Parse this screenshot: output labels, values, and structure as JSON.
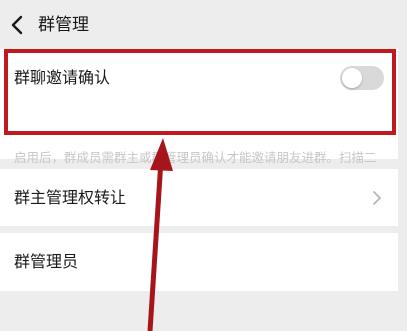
{
  "header": {
    "title": "群管理"
  },
  "settings": {
    "invite_confirm": {
      "label": "群聊邀请确认",
      "enabled": false,
      "description": "启用后，群成员需群主或群管理员确认才能邀请朋友进群。扫描二维码进群将同时停用。"
    },
    "transfer_owner": {
      "label": "群主管理权转让"
    },
    "admins": {
      "label": "群管理员"
    }
  },
  "colors": {
    "background": "#ededed",
    "card": "#ffffff",
    "highlight": "#c0191f",
    "toggle_off": "#d9d9d9",
    "description": "#c7c7c7"
  }
}
